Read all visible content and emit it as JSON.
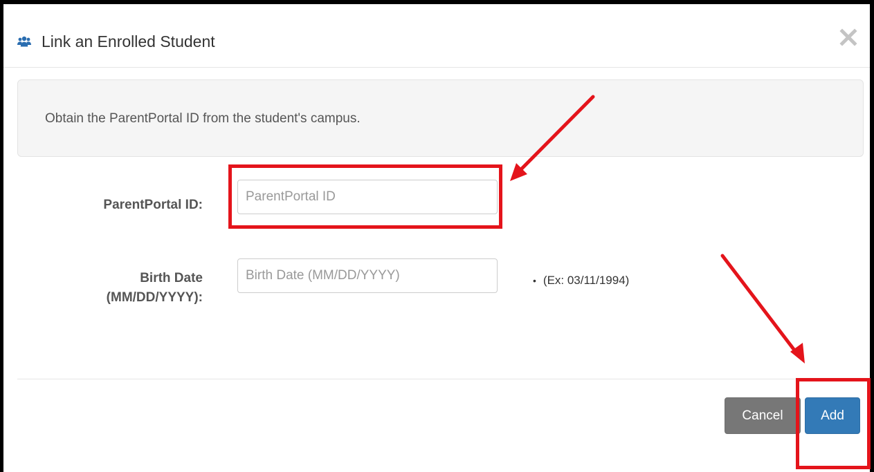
{
  "modal": {
    "title": "Link an Enrolled Student",
    "header_icon": "users-icon",
    "close_icon": "close-icon"
  },
  "alert": {
    "text": "Obtain the ParentPortal ID from the student's campus."
  },
  "form": {
    "parentportal": {
      "label": "ParentPortal ID:",
      "placeholder": "ParentPortal ID",
      "value": ""
    },
    "birthdate": {
      "label_line1": "Birth Date",
      "label_line2": "(MM/DD/YYYY):",
      "placeholder": "Birth Date (MM/DD/YYYY)",
      "value": "",
      "hint": "(Ex: 03/11/1994)"
    }
  },
  "footer": {
    "cancel_label": "Cancel",
    "add_label": "Add"
  },
  "colors": {
    "primary": "#337ab7",
    "cancel": "#777777",
    "annotation": "#e4141b",
    "icon": "#2a6db0"
  }
}
